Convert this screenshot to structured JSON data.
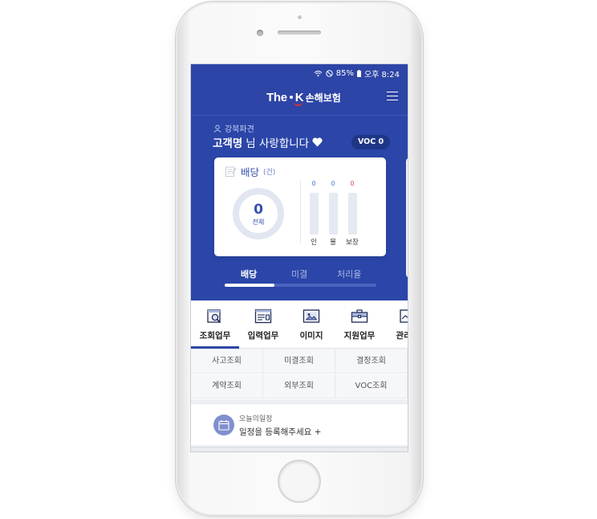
{
  "status_bar": {
    "battery": "85%",
    "time": "오후 8:24"
  },
  "header": {
    "logo_the": "The",
    "logo_k": "K",
    "logo_ko": "손해보험"
  },
  "user": {
    "branch": "강북파견",
    "name": "고객명",
    "greeting_suffix": "님 사랑합니다",
    "voc_badge": "VOC 0"
  },
  "summary_card": {
    "title": "배당",
    "unit": "(건)",
    "total_value": "0",
    "total_label": "전체",
    "bars": [
      {
        "value": "0",
        "label": "인",
        "color": "#4a78d4",
        "level": 0
      },
      {
        "value": "0",
        "label": "물",
        "color": "#4a78d4",
        "level": 0
      },
      {
        "value": "0",
        "label": "보장",
        "color": "#e24b4b",
        "level": 0
      }
    ]
  },
  "sub_tabs": [
    {
      "label": "배당",
      "active": true
    },
    {
      "label": "미결",
      "active": false
    },
    {
      "label": "처리율",
      "active": false
    }
  ],
  "carousel": {
    "progress_fraction": 0.33
  },
  "nav_tabs": [
    {
      "label": "조회업무",
      "icon": "search-document-icon",
      "active": true
    },
    {
      "label": "입력업무",
      "icon": "input-form-icon",
      "active": false
    },
    {
      "label": "이미지",
      "icon": "image-icon",
      "active": false
    },
    {
      "label": "지원업무",
      "icon": "briefcase-icon",
      "active": false
    },
    {
      "label": "관리업",
      "icon": "chart-document-icon",
      "active": false
    }
  ],
  "quick_links": [
    "사고조회",
    "미결조회",
    "결정조회",
    "계약조회",
    "외부조회",
    "VOC조회"
  ],
  "schedule": {
    "label": "오늘의일정",
    "cta": "일정을 등록해주세요 +"
  }
}
